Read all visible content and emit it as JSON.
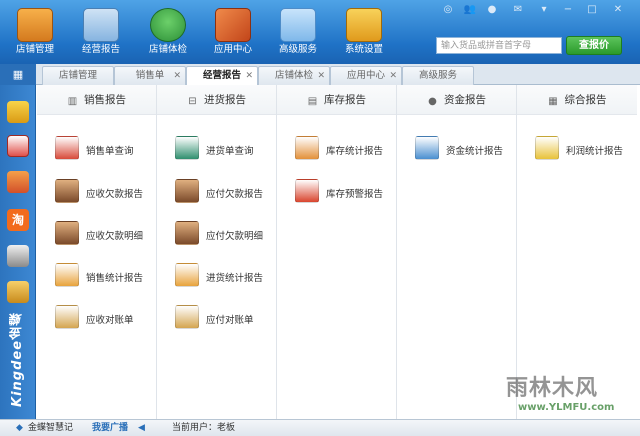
{
  "toolbar": {
    "buttons": [
      {
        "label": "店铺管理",
        "icon": "storefront-icon",
        "color": "#e8912f"
      },
      {
        "label": "经营报告",
        "icon": "report-clipboard-icon",
        "color": "#6aa3d8"
      },
      {
        "label": "店铺体检",
        "icon": "green-house-icon",
        "color": "#3aa84a"
      },
      {
        "label": "应用中心",
        "icon": "app-cube-icon",
        "color": "#e06a2c"
      },
      {
        "label": "高级服务",
        "icon": "cloud-icon",
        "color": "#8ec3ef"
      },
      {
        "label": "系统设置",
        "icon": "gear-box-icon",
        "color": "#f0b42a"
      }
    ]
  },
  "search": {
    "placeholder": "输入货品或拼音首字母",
    "button_label": "查报价"
  },
  "tabs": [
    {
      "label": "店铺管理",
      "closable": false,
      "active": false
    },
    {
      "label": "销售单",
      "closable": true,
      "active": false
    },
    {
      "label": "经营报告",
      "closable": true,
      "active": true
    },
    {
      "label": "店铺体检",
      "closable": true,
      "active": false
    },
    {
      "label": "应用中心",
      "closable": true,
      "active": false
    },
    {
      "label": "高级服务",
      "closable": false,
      "active": false
    }
  ],
  "sidebar": {
    "icons": [
      "coins-icon",
      "calendar-icon",
      "calculator-icon",
      "taobao-icon",
      "shop-icon",
      "abacus-icon"
    ],
    "logo_text": "Kingdee金蝶"
  },
  "columns": [
    {
      "title": "销售报告",
      "icon": "bar-chart-icon",
      "items": [
        {
          "label": "销售单查询",
          "color": "#c0392b"
        },
        {
          "label": "应收欠款报告",
          "color": "#7b4a2a"
        },
        {
          "label": "应收欠款明细",
          "color": "#7b4a2a"
        },
        {
          "label": "销售统计报告",
          "color": "#e8a33c"
        },
        {
          "label": "应收对账单",
          "color": "#d4a550"
        }
      ]
    },
    {
      "title": "进货报告",
      "icon": "cart-icon",
      "items": [
        {
          "label": "进货单查询",
          "color": "#2f8f6e"
        },
        {
          "label": "应付欠款报告",
          "color": "#7b4a2a"
        },
        {
          "label": "应付欠款明细",
          "color": "#7b4a2a"
        },
        {
          "label": "进货统计报告",
          "color": "#e8a33c"
        },
        {
          "label": "应付对账单",
          "color": "#d4a550"
        }
      ]
    },
    {
      "title": "库存报告",
      "icon": "box-icon",
      "items": [
        {
          "label": "库存统计报告",
          "color": "#e3913a"
        },
        {
          "label": "库存预警报告",
          "color": "#d9452e"
        }
      ]
    },
    {
      "title": "资金报告",
      "icon": "coin-icon",
      "items": [
        {
          "label": "资金统计报告",
          "color": "#4a8fd0"
        }
      ]
    },
    {
      "title": "综合报告",
      "icon": "grid-icon",
      "items": [
        {
          "label": "利润统计报告",
          "color": "#e8c23a"
        }
      ]
    }
  ],
  "status": {
    "brand": "金蝶智慧记",
    "broadcast": "我要广播",
    "user_label": "当前用户：老板"
  },
  "watermark": {
    "line1": "雨林木风",
    "line2": "www.YLMFU.com"
  }
}
